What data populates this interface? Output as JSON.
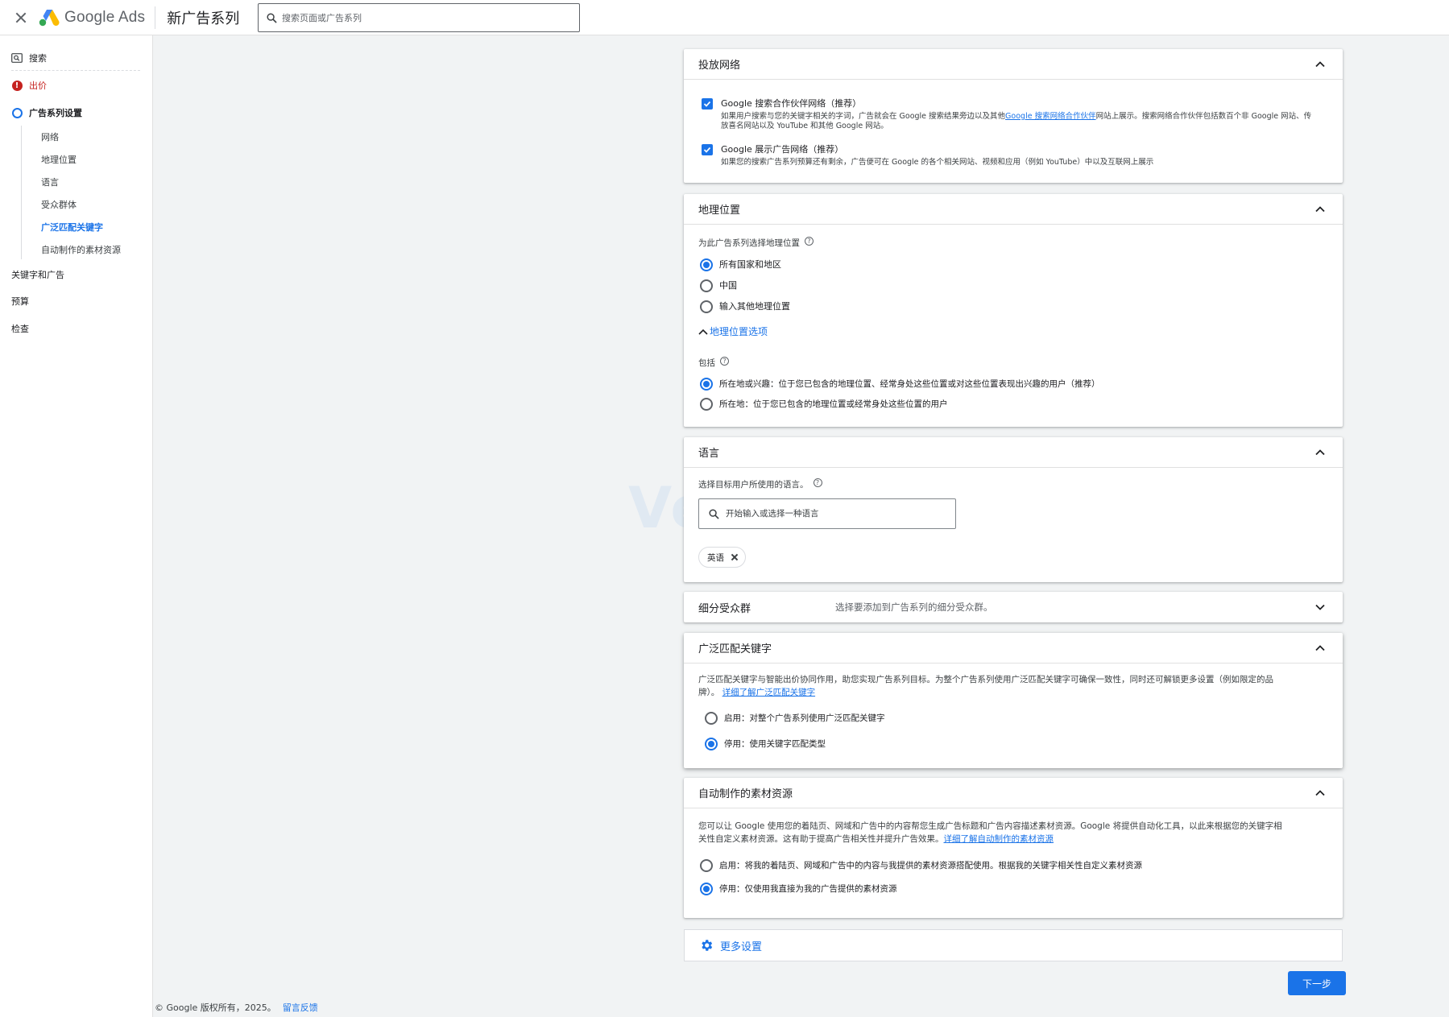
{
  "header": {
    "brand": "Google",
    "product": "Ads",
    "title": "新广告系列",
    "search_placeholder": "搜索页面或广告系列"
  },
  "sidebar": {
    "search": "搜索",
    "bidding": "出价",
    "campaign_settings": "广告系列设置",
    "sub_items": [
      "网络",
      "地理位置",
      "语言",
      "受众群体",
      "广泛匹配关键字",
      "自动制作的素材资源"
    ],
    "active_sub": "广泛匹配关键字",
    "keywords_ads": "关键字和广告",
    "budget": "预算",
    "review": "检查"
  },
  "networks": {
    "title": "投放网络",
    "search_partners": {
      "label": "Google 搜索合作伙伴网络（推荐）",
      "desc_before": "如果用户搜索与您的关键字相关的字词，广告就会在 Google 搜索结果旁边以及其他",
      "desc_link": "Google 搜索网络合作伙伴",
      "desc_after": "网站上展示。搜索网络合作伙伴包括数百个非 Google 网站、传",
      "desc_line2": "放喜名网站以及 YouTube 和其他 Google 网站。",
      "checked": true
    },
    "display": {
      "label": "Google 展示广告网络（推荐）",
      "desc": "如果您的搜索广告系列预算还有剩余，广告便可在 Google 的各个相关网站、视频和应用（例如 YouTube）中以及互联网上展示",
      "checked": true
    }
  },
  "location": {
    "title": "地理位置",
    "prompt": "为此广告系列选择地理位置",
    "options": [
      "所有国家和地区",
      "中国",
      "输入其他地理位置"
    ],
    "selected": 0,
    "options_toggle": "地理位置选项",
    "include_label": "包括",
    "include_options": [
      "所在地或兴趣：位于您已包含的地理位置、经常身处这些位置或对这些位置表现出兴趣的用户（推荐）",
      "所在地：位于您已包含的地理位置或经常身处这些位置的用户"
    ],
    "include_selected": 0
  },
  "language": {
    "title": "语言",
    "prompt": "选择目标用户所使用的语言。",
    "input_placeholder": "开始输入或选择一种语言",
    "chip": "英语"
  },
  "audience": {
    "title": "细分受众群",
    "summary": "选择要添加到广告系列的细分受众群。"
  },
  "broad_match": {
    "title": "广泛匹配关键字",
    "desc_line1": "广泛匹配关键字与智能出价协同作用，助您实现广告系列目标。为整个广告系列使用广泛匹配关键字可确保一致性，同时还可解锁更多设置（例如限定的品",
    "desc_line2": "牌）。",
    "desc_link": "详细了解广泛匹配关键字",
    "options": [
      "启用：对整个广告系列使用广泛匹配关键字",
      "停用：使用关键字匹配类型"
    ],
    "selected": 1
  },
  "auto_assets": {
    "title": "自动制作的素材资源",
    "desc_line1": "您可以让 Google 使用您的着陆页、网域和广告中的内容帮您生成广告标题和广告内容描述素材资源。Google 将提供自动化工具，以此来根据您的关键字相",
    "desc_line2": "关性自定义素材资源。这有助于提高广告相关性并提升广告效果。",
    "desc_link": "详细了解自动制作的素材资源",
    "options": [
      "启用：将我的着陆页、网域和广告中的内容与我提供的素材资源搭配使用。根据我的关键字相关性自定义素材资源",
      "停用：仅使用我直接为我的广告提供的素材资源"
    ],
    "selected": 1
  },
  "more_settings": "更多设置",
  "next_button": "下一步",
  "footer": {
    "copyright": "© Google 版权所有，2025。",
    "feedback": "留言反馈"
  },
  "watermark": "VeryFib",
  "colors": {
    "accent": "#1a73e8",
    "error": "#c5221f"
  }
}
